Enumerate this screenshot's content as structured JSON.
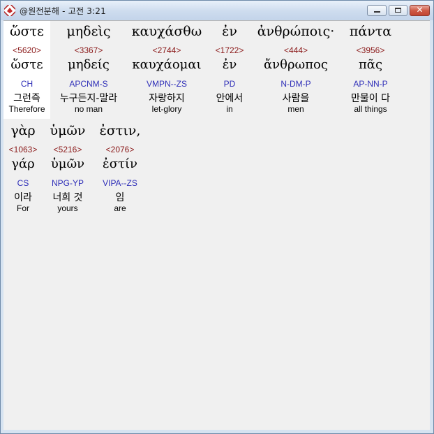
{
  "window": {
    "title": "@원전분해 - 고전 3:21"
  },
  "lines": [
    [
      {
        "greek": "ὥστε",
        "strong": "<5620>",
        "lemma": "ὥστε",
        "parse": "CH",
        "korean": "그런즉",
        "english": "Therefore"
      },
      {
        "greek": "μηδεὶς",
        "strong": "<3367>",
        "lemma": "μηδείς",
        "parse": "APCNM-S",
        "korean": "누구든지-말라",
        "english": "no man"
      },
      {
        "greek": "καυχάσθω",
        "strong": "<2744>",
        "lemma": "καυχάομαι",
        "parse": "VMPN--ZS",
        "korean": "자랑하지",
        "english": "let-glory"
      },
      {
        "greek": "ἐν",
        "strong": "<1722>",
        "lemma": "ἐν",
        "parse": "PD",
        "korean": "안에서",
        "english": "in"
      },
      {
        "greek": "ἀνθρώποις·",
        "strong": "<444>",
        "lemma": "ἄνθρωπος",
        "parse": "N-DM-P",
        "korean": "사람을",
        "english": "men"
      },
      {
        "greek": "πάντα",
        "strong": "<3956>",
        "lemma": "πᾶς",
        "parse": "AP-NN-P",
        "korean": "만물이 다",
        "english": "all things"
      }
    ],
    [
      {
        "greek": "γὰρ",
        "strong": "<1063>",
        "lemma": "γάρ",
        "parse": "CS",
        "korean": "이라",
        "english": "For"
      },
      {
        "greek": "ὑμῶν",
        "strong": "<5216>",
        "lemma": "ὑμῶν",
        "parse": "NPG-YP",
        "korean": "너희 것",
        "english": "yours"
      },
      {
        "greek": "ἐστιν,",
        "strong": "<2076>",
        "lemma": "ἐστίν",
        "parse": "VIPA--ZS",
        "korean": "임",
        "english": "are"
      }
    ]
  ]
}
